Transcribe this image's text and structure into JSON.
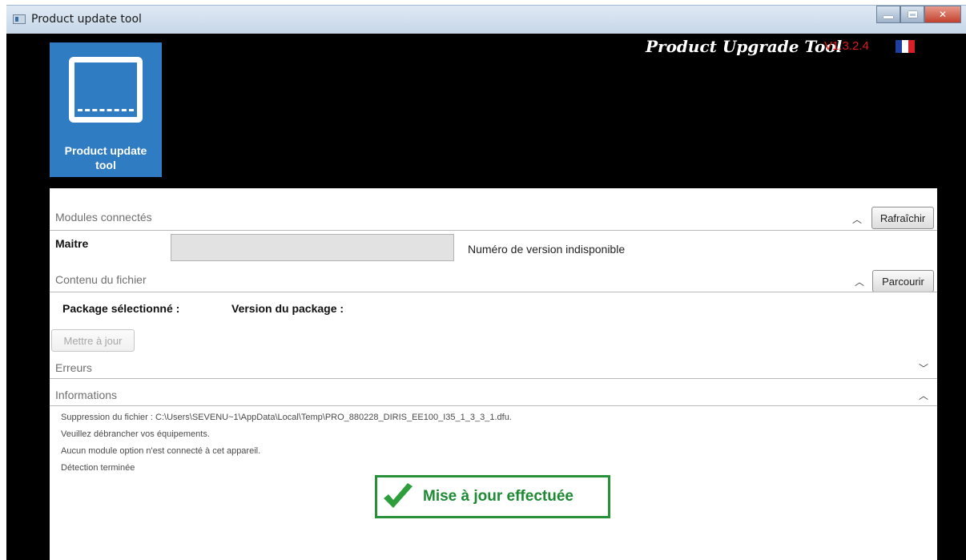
{
  "window": {
    "title": "Product update tool",
    "controls": [
      "minimize",
      "maximize",
      "close"
    ]
  },
  "header": {
    "brand": "Product Upgrade Tool",
    "version": "V1.3.2.4",
    "language_flag": "flag-france-icon"
  },
  "tile": {
    "label_line1": "Product update",
    "label_line2": "tool",
    "icon": "monitor-icon"
  },
  "modules": {
    "title": "Modules connectés",
    "refresh_label": "Rafraîchir",
    "master_label": "Maitre",
    "version_status": "Numéro de version indisponible"
  },
  "file": {
    "title": "Contenu du fichier",
    "browse_label": "Parcourir",
    "package_selected_label": "Package sélectionné :",
    "package_version_label": "Version du package :",
    "update_label": "Mettre à jour"
  },
  "errors": {
    "title": "Erreurs"
  },
  "informations": {
    "title": "Informations",
    "log": [
      "Suppression du fichier : C:\\Users\\SEVENU~1\\AppData\\Local\\Temp\\PRO_880228_DIRIS_EE100_I35_1_3_3_1.dfu.",
      "Veuillez débrancher vos équipements.",
      "Aucun module option n'est connecté à cet appareil.",
      "Détection terminée"
    ],
    "success_message": "Mise à jour effectuée"
  },
  "colors": {
    "tile_blue": "#2f7cc2",
    "version_red": "#e01818",
    "success_green": "#27913a"
  }
}
